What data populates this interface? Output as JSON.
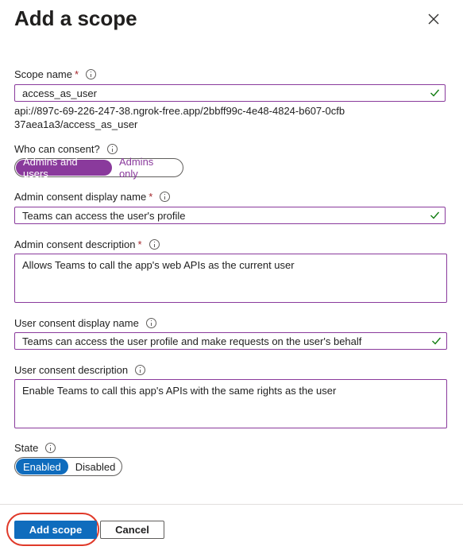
{
  "panel": {
    "title": "Add a scope",
    "close_icon": "close-icon"
  },
  "scope_name": {
    "label": "Scope name",
    "required": "*",
    "value": "access_as_user",
    "uri": "api://897c-69-226-247-38.ngrok-free.app/2bbff99c-4e48-4824-b607-0cfb37aea1a3/access_as_user"
  },
  "who_can_consent": {
    "label": "Who can consent?",
    "options": [
      "Admins and users",
      "Admins only"
    ],
    "selected": "Admins and users"
  },
  "admin_display_name": {
    "label": "Admin consent display name",
    "required": "*",
    "value": "Teams can access the user's profile"
  },
  "admin_description": {
    "label": "Admin consent description",
    "required": "*",
    "value": "Allows Teams to call the app's web APIs as the current user"
  },
  "user_display_name": {
    "label": "User consent display name",
    "value": "Teams can access the user profile and make requests on the user's behalf"
  },
  "user_description": {
    "label": "User consent description",
    "value": "Enable Teams to call this app's APIs with the same rights as the user"
  },
  "state": {
    "label": "State",
    "options": [
      "Enabled",
      "Disabled"
    ],
    "selected": "Enabled"
  },
  "footer": {
    "add_label": "Add scope",
    "cancel_label": "Cancel"
  },
  "colors": {
    "accent_purple": "#8a3a9c",
    "primary_blue": "#0f6cbd",
    "valid_green": "#107c10",
    "highlight_red": "#e03a2a",
    "required_red": "#a4262c"
  }
}
